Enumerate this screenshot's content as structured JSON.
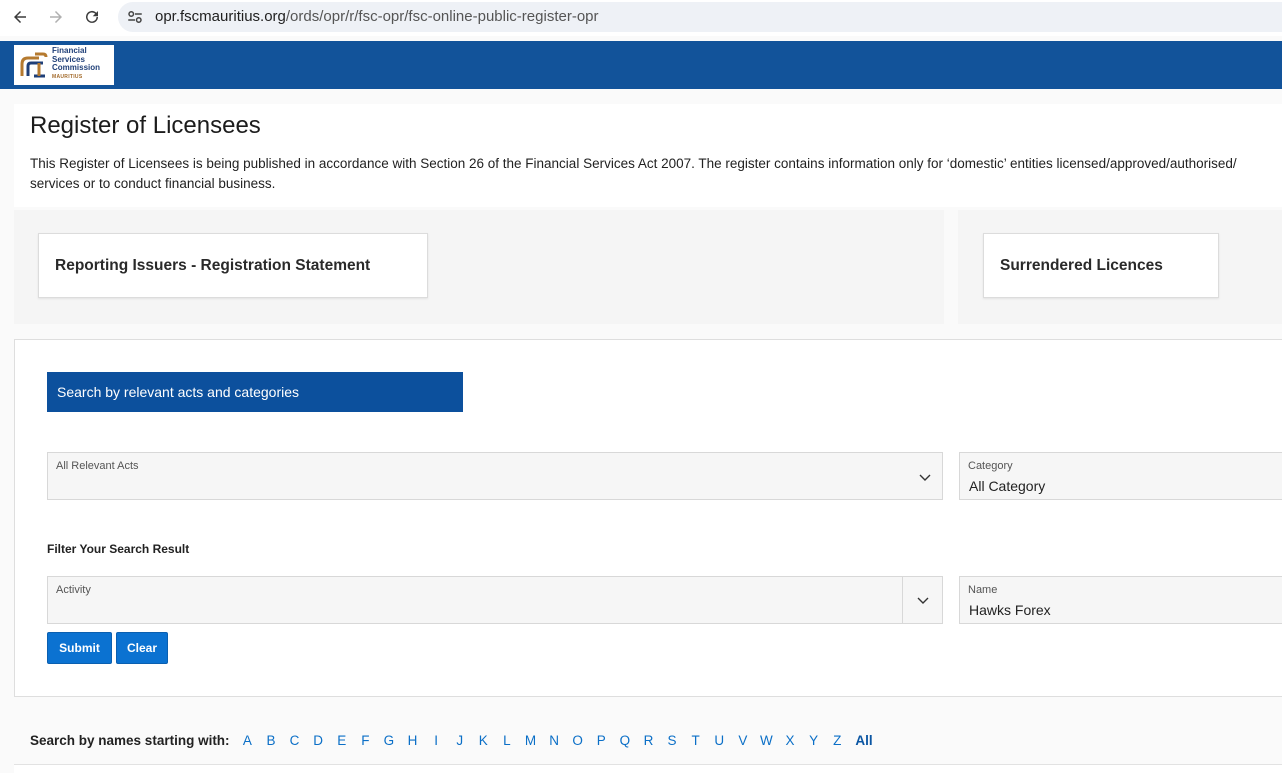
{
  "browser": {
    "url_host": "opr.fscmauritius.org",
    "url_path": "/ords/opr/r/fsc-opr/fsc-online-public-register-opr"
  },
  "header": {
    "logo_text": "Financial\nServices\nCommission",
    "logo_sub": "MAURITIUS",
    "band_color": "#12539a"
  },
  "intro": {
    "title": "Register of Licensees",
    "text_line1": "This Register of Licensees is being published in accordance with Section 26 of the Financial Services Act 2007. The register contains information only for ‘domestic’ entities licensed/approved/authorised/",
    "text_line2": "services or to conduct financial business."
  },
  "cards": {
    "reporting_issuers": "Reporting Issuers - Registration Statement",
    "surrendered": "Surrendered Licences"
  },
  "search": {
    "heading": "Search by relevant acts and categories",
    "acts_label": "All Relevant Acts",
    "acts_value": "",
    "category_label": "Category",
    "category_value": "All Category",
    "filter_title": "Filter Your Search Result",
    "activity_label": "Activity",
    "activity_value": "",
    "name_label": "Name",
    "name_value": "Hawks Forex",
    "submit_label": "Submit",
    "clear_label": "Clear",
    "accent_color": "#0b72d1"
  },
  "alphabet": {
    "label": "Search by names starting with:",
    "letters": [
      "A",
      "B",
      "C",
      "D",
      "E",
      "F",
      "G",
      "H",
      "I",
      "J",
      "K",
      "L",
      "M",
      "N",
      "O",
      "P",
      "Q",
      "R",
      "S",
      "T",
      "U",
      "V",
      "W",
      "X",
      "Y",
      "Z"
    ],
    "all_label": "All"
  }
}
